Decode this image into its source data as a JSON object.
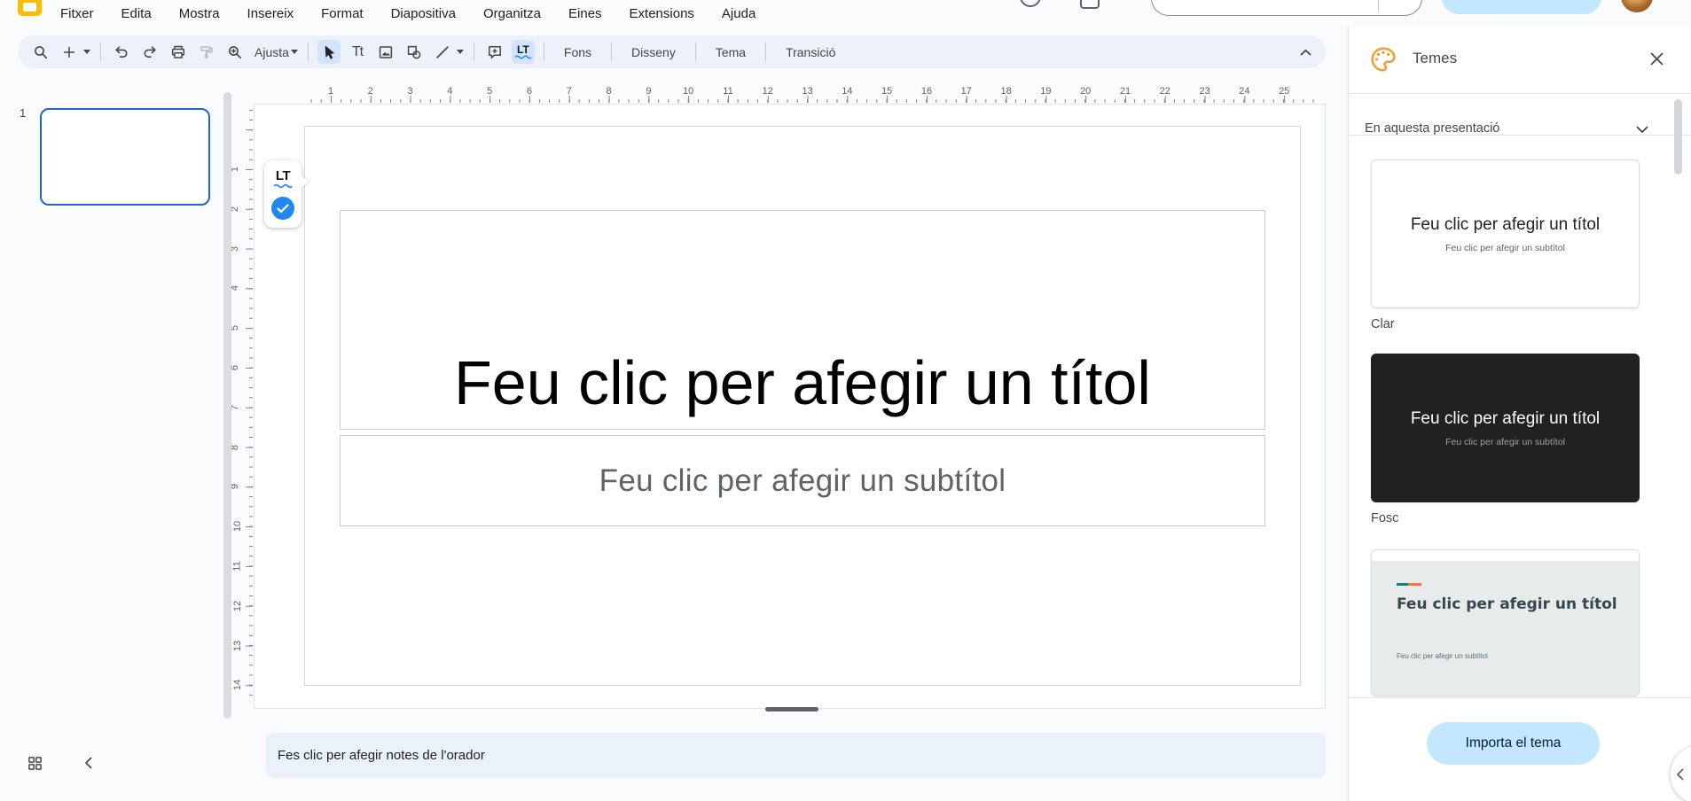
{
  "menu_bar": {
    "items": [
      "Fitxer",
      "Edita",
      "Mostra",
      "Insereix",
      "Format",
      "Diapositiva",
      "Organitza",
      "Eines",
      "Extensions",
      "Ajuda"
    ]
  },
  "toolbar": {
    "fit_label": "Ajusta",
    "text_box_icon_label": "Tt",
    "format_buttons": [
      "Fons",
      "Disseny",
      "Tema",
      "Transició"
    ],
    "icon_names": [
      "search-icon",
      "new-slide-icon",
      "undo-icon",
      "redo-icon",
      "print-icon",
      "paint-format-icon",
      "zoom-in-icon",
      "select-cursor-icon",
      "text-box-icon",
      "insert-image-icon",
      "insert-shape-icon",
      "insert-line-icon",
      "insert-comment-icon",
      "languagetool-icon",
      "collapse-menus-icon"
    ]
  },
  "rulers": {
    "horizontal": [
      1,
      2,
      3,
      4,
      5,
      6,
      7,
      8,
      9,
      10,
      11,
      12,
      13,
      14,
      15,
      16,
      17,
      18,
      19,
      20,
      21,
      22,
      23,
      24,
      25
    ],
    "vertical": [
      1,
      2,
      3,
      4,
      5,
      6,
      7,
      8,
      9,
      10,
      11,
      12,
      13,
      14
    ]
  },
  "filmstrip": {
    "slide_number": "1"
  },
  "slide": {
    "title_placeholder": "Feu clic per afegir un títol",
    "subtitle_placeholder": "Feu clic per afegir un subtítol"
  },
  "extensions": {
    "languagetool_label": "LT"
  },
  "notes": {
    "placeholder": "Fes clic per afegir notes de l'orador"
  },
  "themes_panel": {
    "title": "Temes",
    "section_label": "En aquesta presentació",
    "import_button": "Importa el tema",
    "themes": [
      {
        "name": "Clar",
        "title": "Feu clic per afegir un títol",
        "subtitle": "Feu clic per afegir un subtítol",
        "style": "light"
      },
      {
        "name": "Fosc",
        "title": "Feu clic per afegir un títol",
        "subtitle": "Feu clic per afegir un subtítol",
        "style": "dark"
      },
      {
        "name": "",
        "title": "Feu clic per afegir un títol",
        "subtitle": "Feu clic per afegir un subtítol",
        "style": "focus"
      }
    ]
  },
  "colors": {
    "accent_blue": "#1a73e8",
    "toolbar_bg": "#edf2fa",
    "selection_bg": "#d3e3fd",
    "import_button_bg": "#c2e7ff",
    "dark_theme_bg": "#212121",
    "focus_theme_bg": "#e7eceb",
    "notes_bg": "#eaf1fb",
    "slides_logo_yellow": "#fbbc04"
  }
}
